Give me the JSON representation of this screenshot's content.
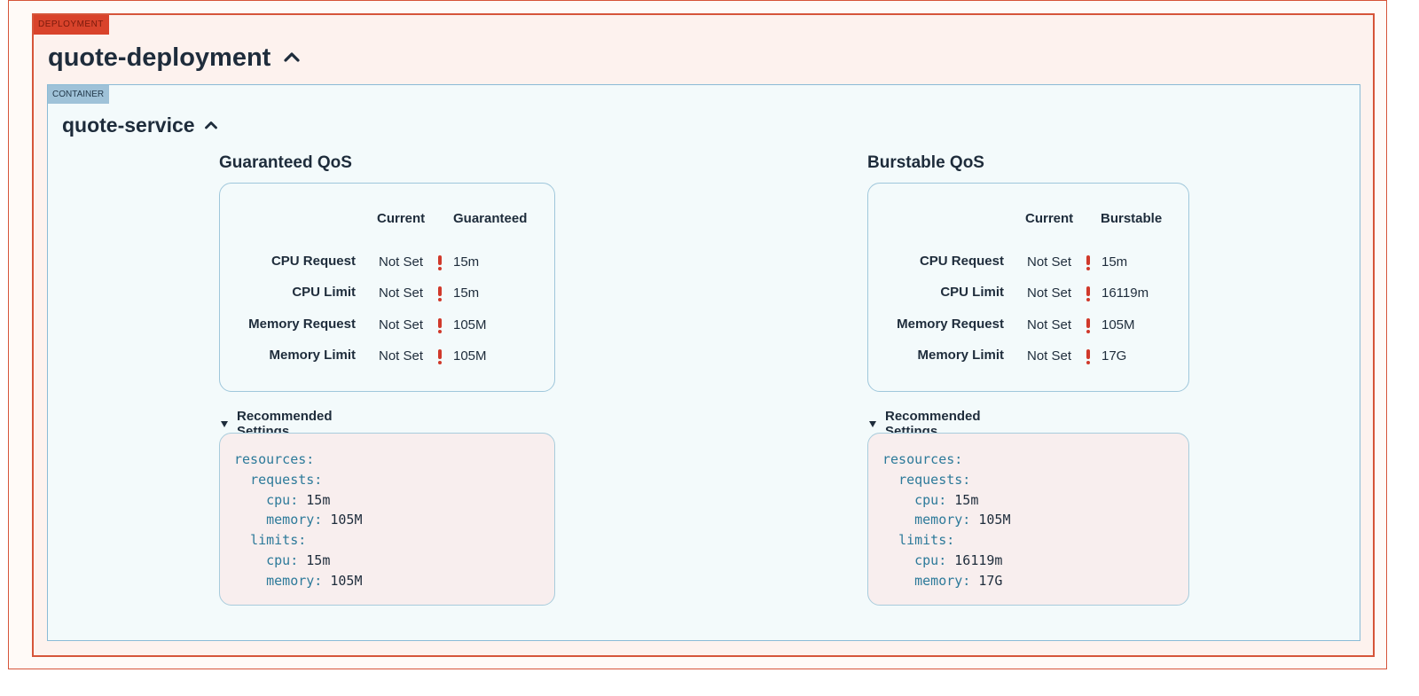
{
  "deployment": {
    "tag": "DEPLOYMENT",
    "name": "quote-deployment"
  },
  "container": {
    "tag": "CONTAINER",
    "name": "quote-service"
  },
  "colors": {
    "deployment_border": "#d6553a",
    "container_border": "#8bbbd6",
    "warning": "#d0392b"
  },
  "panels": [
    {
      "title": "Guaranteed QoS",
      "col_current": "Current",
      "col_target": "Guaranteed",
      "rows": [
        {
          "label": "CPU Request",
          "current": "Not Set",
          "target": "15m",
          "warn_icon": "exclamation-icon"
        },
        {
          "label": "CPU Limit",
          "current": "Not Set",
          "target": "15m",
          "warn_icon": "exclamation-icon"
        },
        {
          "label": "Memory Request",
          "current": "Not Set",
          "target": "105M",
          "warn_icon": "exclamation-icon"
        },
        {
          "label": "Memory Limit",
          "current": "Not Set",
          "target": "105M",
          "warn_icon": "exclamation-icon"
        }
      ],
      "recommended_label": "Recommended Settings",
      "yaml": {
        "resources": "resources:",
        "requests": "requests:",
        "req_cpu_key": "cpu:",
        "req_cpu": "15m",
        "req_mem_key": "memory:",
        "req_mem": "105M",
        "limits": "limits:",
        "lim_cpu_key": "cpu:",
        "lim_cpu": "15m",
        "lim_mem_key": "memory:",
        "lim_mem": "105M"
      }
    },
    {
      "title": "Burstable QoS",
      "col_current": "Current",
      "col_target": "Burstable",
      "rows": [
        {
          "label": "CPU Request",
          "current": "Not Set",
          "target": "15m",
          "warn_icon": "exclamation-icon"
        },
        {
          "label": "CPU Limit",
          "current": "Not Set",
          "target": "16119m",
          "warn_icon": "exclamation-icon"
        },
        {
          "label": "Memory Request",
          "current": "Not Set",
          "target": "105M",
          "warn_icon": "exclamation-icon"
        },
        {
          "label": "Memory Limit",
          "current": "Not Set",
          "target": "17G",
          "warn_icon": "exclamation-icon"
        }
      ],
      "recommended_label": "Recommended Settings",
      "yaml": {
        "resources": "resources:",
        "requests": "requests:",
        "req_cpu_key": "cpu:",
        "req_cpu": "15m",
        "req_mem_key": "memory:",
        "req_mem": "105M",
        "limits": "limits:",
        "lim_cpu_key": "cpu:",
        "lim_cpu": "16119m",
        "lim_mem_key": "memory:",
        "lim_mem": "17G"
      }
    }
  ]
}
